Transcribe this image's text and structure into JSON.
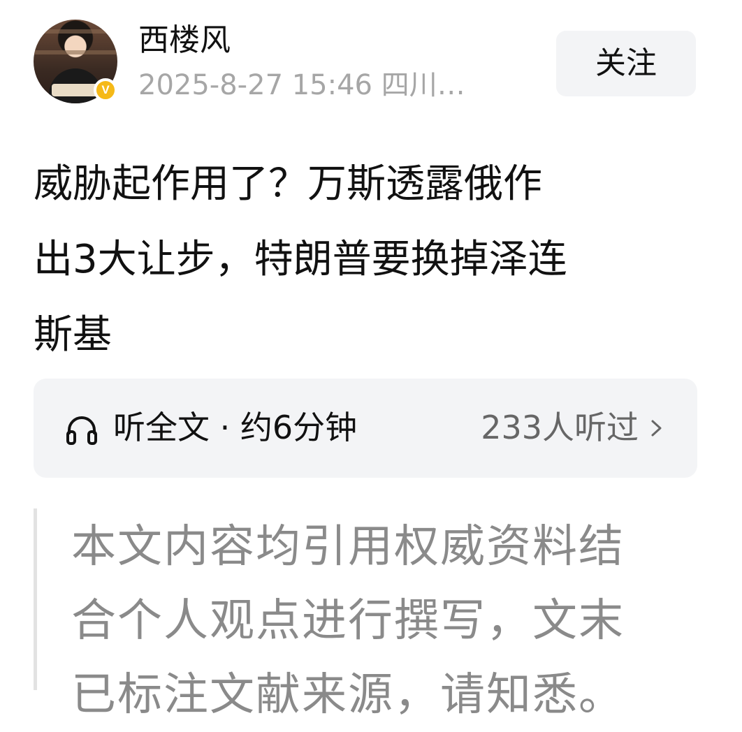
{
  "author": {
    "name": "西楼风",
    "meta": "2025-8-27 15:46 四川…",
    "verified_badge": "V",
    "avatar_icon": "user-avatar"
  },
  "follow_button": {
    "label": "关注"
  },
  "article": {
    "title_lines": [
      "威胁起作用了？万斯透露俄作",
      "出3大让步，特朗普要换掉泽连",
      "斯基"
    ]
  },
  "listen": {
    "label": "听全文 · 约6分钟",
    "count": "233人听过",
    "icon": "headphones-icon",
    "chevron_icon": "chevron-right-icon"
  },
  "quote": {
    "lines": [
      "本文内容均引用权威资料结",
      "合个人观点进行撰写，文末",
      "已标注文献来源，请知悉。"
    ]
  },
  "colors": {
    "background": "#ffffff",
    "text_primary": "#111111",
    "text_muted": "#a6a6a6",
    "card_background": "#f3f4f6",
    "badge": "#f5b918",
    "quote_bar": "#e2e2e2",
    "quote_text": "#8a8a8a"
  }
}
